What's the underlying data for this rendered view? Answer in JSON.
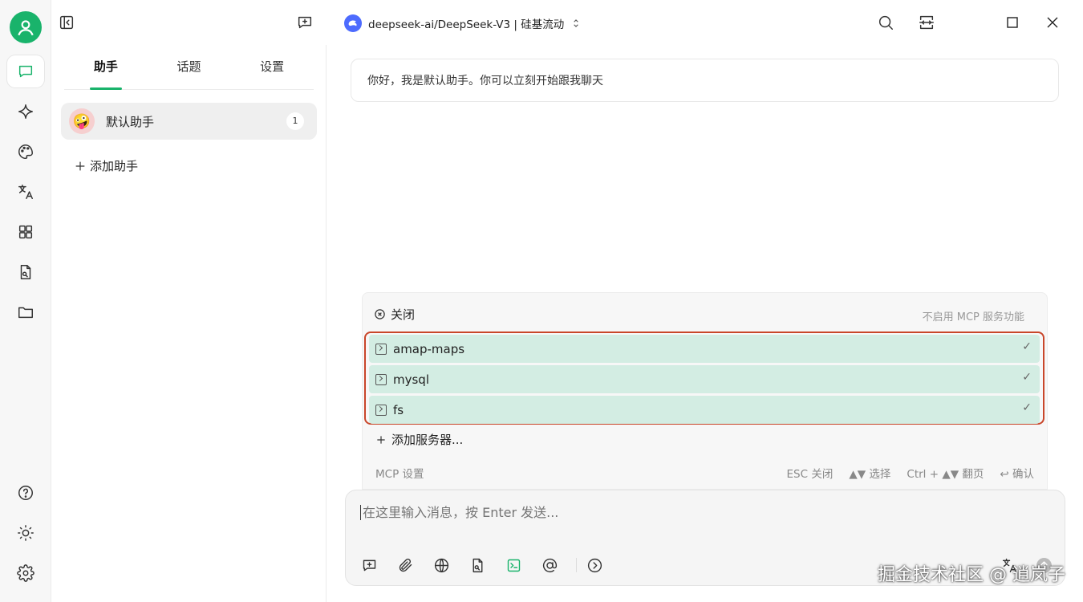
{
  "titlebar": {
    "model": "deepseek-ai/DeepSeek-V3 | 硅基流动"
  },
  "sidebar": {
    "tabs": [
      {
        "label": "助手"
      },
      {
        "label": "话题"
      },
      {
        "label": "设置"
      }
    ],
    "assistant": {
      "emoji": "🤪",
      "name": "默认助手",
      "count": "1"
    },
    "add_assistant": "添加助手"
  },
  "chat": {
    "welcome": "你好，我是默认助手。你可以立刻开始跟我聊天"
  },
  "mcp": {
    "close": "关闭",
    "close_hint": "不启用 MCP 服务功能",
    "servers": [
      {
        "name": "amap-maps",
        "check": "✓"
      },
      {
        "name": "mysql",
        "check": "✓"
      },
      {
        "name": "fs",
        "check": "✓"
      }
    ],
    "add_server": "添加服务器...",
    "footer": {
      "settings": "MCP 设置",
      "esc": "ESC 关闭",
      "select": "▲▼ 选择",
      "page": "Ctrl + ▲▼ 翻页",
      "confirm": "↩ 确认"
    }
  },
  "input": {
    "placeholder": "在这里输入消息，按 Enter 发送..."
  },
  "watermark": "掘金技术社区 @ 逍岚子",
  "colors": {
    "accent": "#19b36b",
    "highlight_border": "#c9462a",
    "server_bg": "#d3ede3"
  }
}
